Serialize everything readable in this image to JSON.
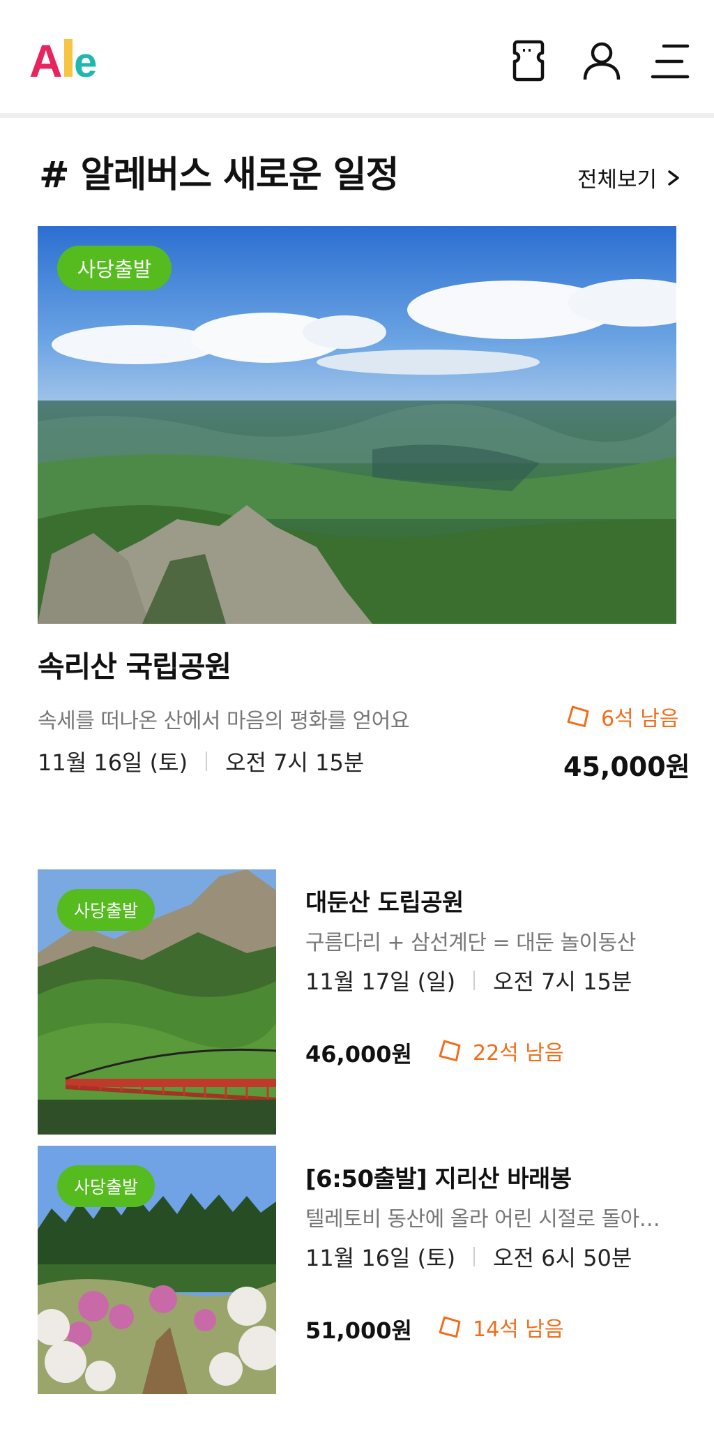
{
  "header": {
    "logo_text": "Alle",
    "logo_colors": [
      "#e8245f",
      "#f6c544",
      "#1fb8b0"
    ]
  },
  "section": {
    "title": "# 알레버스 새로운 일정",
    "view_all_label": "전체보기"
  },
  "featured": {
    "badge": "사당출발",
    "title": "속리산 국립공원",
    "description": "속세를 떠나온 산에서 마음의 평화를 얻어요",
    "seats": "6석 남음",
    "date": "11월 16일 (토)",
    "time": "오전 7시 15분",
    "price": "45,000원"
  },
  "list": [
    {
      "badge": "사당출발",
      "title": "대둔산 도립공원",
      "description": "구름다리 + 삼선계단 = 대둔 놀이동산",
      "date": "11월 17일 (일)",
      "time": "오전 7시 15분",
      "price": "46,000원",
      "seats": "22석 남음"
    },
    {
      "badge": "사당출발",
      "title": "[6:50출발] 지리산 바래봉",
      "description": "텔레토비 동산에 올라 어린 시절로 돌아가요",
      "date": "11월 16일 (토)",
      "time": "오전 6시 50분",
      "price": "51,000원",
      "seats": "14석 남음"
    }
  ],
  "colors": {
    "badge_green": "#55bb1f",
    "seats_orange": "#f26d19"
  },
  "icons": [
    "ticket-icon",
    "user-icon",
    "menu-icon",
    "chevron-right-icon",
    "ticket-tag-icon"
  ]
}
